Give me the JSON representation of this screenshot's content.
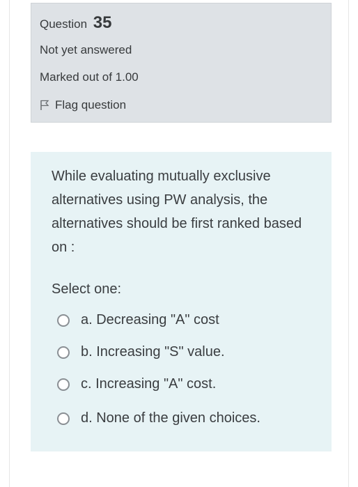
{
  "question_info": {
    "question_word": "Question",
    "question_number": "35",
    "state": "Not yet answered",
    "grade": "Marked out of 1.00",
    "flag_label": "Flag question"
  },
  "question": {
    "text": "While evaluating mutually exclusive alternatives using PW analysis, the alternatives should be first ranked based on :",
    "prompt": "Select one:",
    "answers": [
      {
        "label": "a. Decreasing \"A\" cost",
        "selected": false
      },
      {
        "label": "b. Increasing \"S\" value.",
        "selected": false
      },
      {
        "label": "c. Increasing \"A\" cost.",
        "selected": false
      },
      {
        "label": "d. None of the given choices.",
        "selected": false
      }
    ]
  },
  "icons": {
    "flag": "flag-icon",
    "radio": "radio-unchecked-icon"
  },
  "colors": {
    "info_panel_bg": "#dee2e6",
    "content_panel_bg": "#e7f3f5",
    "text": "#373a3c"
  }
}
